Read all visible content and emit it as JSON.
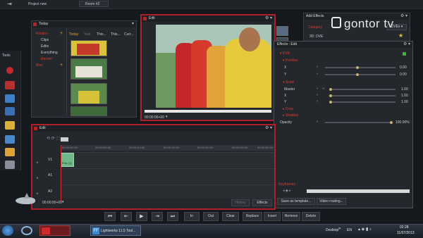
{
  "topbar": {
    "project_label": "Project new",
    "room_label": "Room #2"
  },
  "tools": {
    "title": "Tools"
  },
  "browser": {
    "title": "Today",
    "tree": [
      {
        "label": "Folders",
        "color": "red"
      },
      {
        "label": "Clips",
        "color": "normal"
      },
      {
        "label": "Edits",
        "color": "normal"
      },
      {
        "label": "Everything",
        "color": "normal"
      },
      {
        "label": "Recent",
        "color": "red"
      },
      {
        "label": "Bins",
        "color": "red"
      }
    ],
    "tabs": [
      "Today",
      "Yest.",
      "This...",
      "This...",
      "Curr..."
    ]
  },
  "player": {
    "title": "Edit",
    "timecode": "00:00:00+00"
  },
  "add_effects": {
    "title": "Add Effects",
    "category_label": "Category",
    "category_value": "DVEx",
    "item": "3D: DVE"
  },
  "effects_edit": {
    "title": "Effects : Edit",
    "sections": {
      "dve": "DVE",
      "position": "Position",
      "x_label": "X",
      "y_label": "Y",
      "x_value": "0.00",
      "y_value": "0.00",
      "scale": "Scale",
      "master_label": "Master",
      "sx_label": "X",
      "sy_label": "Y",
      "master_value": "1.00",
      "sx_value": "1.00",
      "sy_value": "1.00",
      "crop": "Crop",
      "shadow": "Shadow",
      "opacity_label": "Opacity",
      "opacity_value": "100.00%"
    },
    "keyframes_label": "Keyframes",
    "save_template": "Save as template...",
    "video_routing": "Video routing..."
  },
  "timeline": {
    "title": "Edit",
    "ruler": [
      "00:00:00+00",
      "00:00:05+00",
      "00:00:10+00",
      "00:00:15+00",
      "00:00:20+00",
      "00:00:25+00",
      "00:00:30+00"
    ],
    "tracks": [
      "V1",
      "A1",
      "A2"
    ],
    "clip_label": "Pos: (1)",
    "timecode": "00:00:00+00",
    "btn_history": "History",
    "btn_effects": "Effects"
  },
  "transport": {
    "in": "In",
    "out": "Out",
    "clear": "Clear",
    "replace": "Replace",
    "insert": "Insert",
    "remove": "Remove",
    "delete": "Delete"
  },
  "watermark": "gontor tv",
  "taskbar": {
    "app_label": "Lightworks 11.5 Tool...",
    "desktop": "Desktop",
    "lang": "EN",
    "time": "02:28",
    "date": "11/07/2013"
  },
  "colors": {
    "accent": "#c11d27",
    "panel": "#24282d",
    "bg": "#15181c"
  }
}
